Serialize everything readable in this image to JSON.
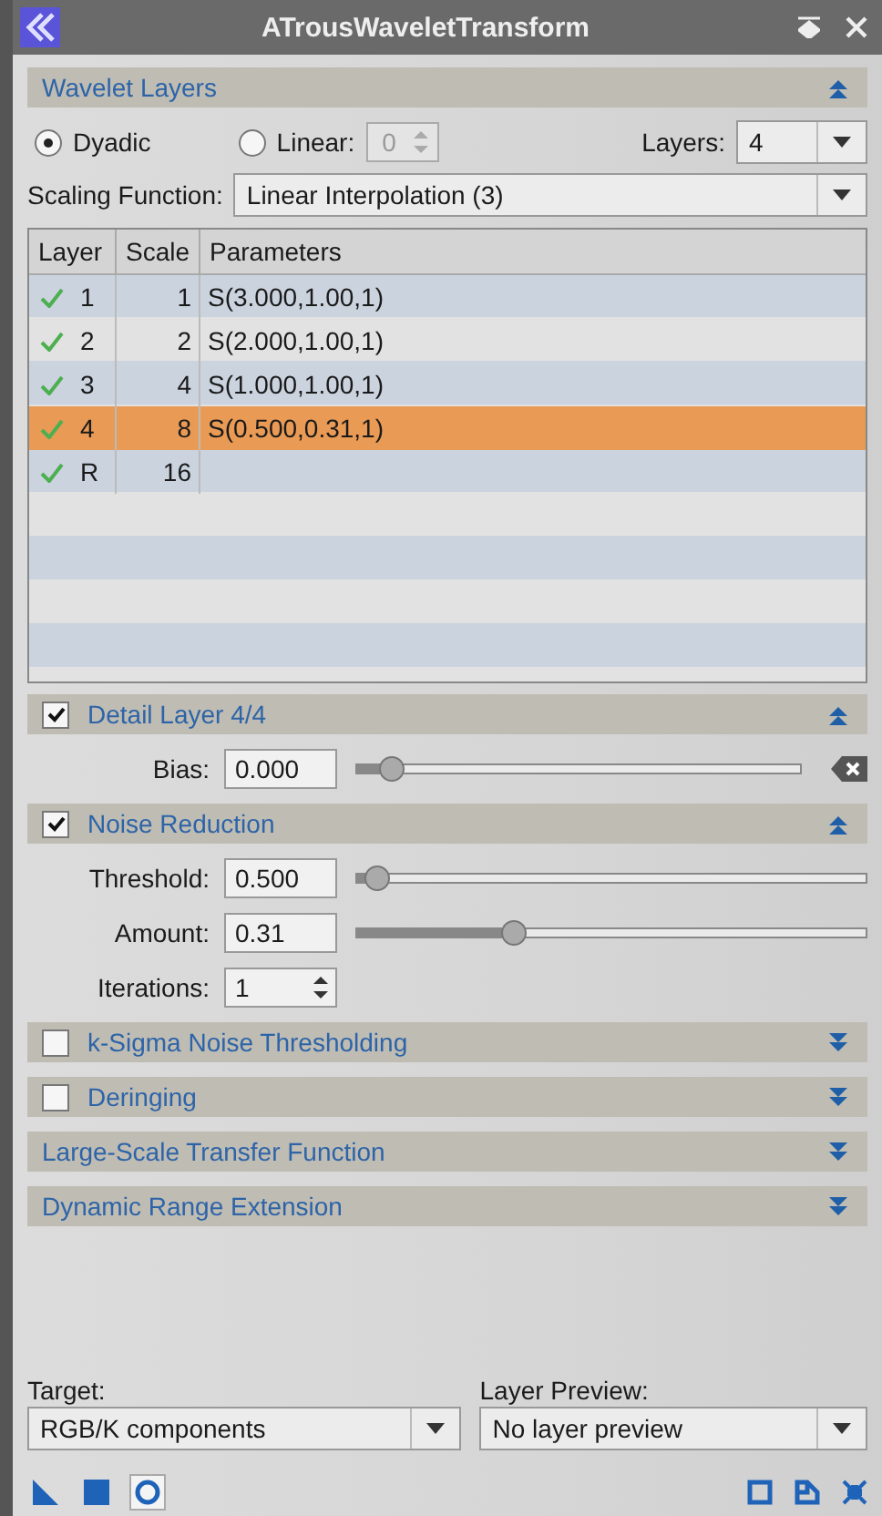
{
  "window": {
    "title": "ATrousWaveletTransform"
  },
  "wavelet_layers": {
    "title": "Wavelet Layers",
    "expanded": true,
    "modes": [
      {
        "label": "Dyadic",
        "selected": true
      },
      {
        "label": "Linear:",
        "selected": false,
        "value": "0"
      }
    ],
    "layers": {
      "label": "Layers:",
      "value": "4"
    },
    "scaling_function": {
      "label": "Scaling Function:",
      "value": "Linear Interpolation (3)"
    },
    "table": {
      "columns": [
        "Layer",
        "Scale",
        "Parameters"
      ],
      "rows": [
        {
          "enabled": true,
          "layer": "1",
          "scale": "1",
          "parameters": "S(3.000,1.00,1)",
          "selected": false
        },
        {
          "enabled": true,
          "layer": "2",
          "scale": "2",
          "parameters": "S(2.000,1.00,1)",
          "selected": false
        },
        {
          "enabled": true,
          "layer": "3",
          "scale": "4",
          "parameters": "S(1.000,1.00,1)",
          "selected": false
        },
        {
          "enabled": true,
          "layer": "4",
          "scale": "8",
          "parameters": "S(0.500,0.31,1)",
          "selected": true
        },
        {
          "enabled": true,
          "layer": "R",
          "scale": "16",
          "selected": false
        }
      ]
    }
  },
  "detail_layer": {
    "title": "Detail Layer 4/4",
    "checked": true,
    "expanded": true,
    "bias": {
      "label": "Bias:",
      "value": "0.000",
      "level": 0.08
    }
  },
  "noise_reduction": {
    "title": "Noise Reduction",
    "checked": true,
    "expanded": true,
    "threshold": {
      "label": "Threshold:",
      "value": "0.500",
      "level": 0.04
    },
    "amount": {
      "label": "Amount:",
      "value": "0.31",
      "level": 0.31
    },
    "iterations": {
      "label": "Iterations:",
      "value": "1"
    }
  },
  "collapsed_sections": [
    {
      "kind": "checkbox",
      "title": "k-Sigma Noise Thresholding",
      "checked": false,
      "expanded": false
    },
    {
      "kind": "checkbox",
      "title": "Deringing",
      "checked": false,
      "expanded": false
    },
    {
      "kind": "plain",
      "title": "Large-Scale Transfer Function",
      "expanded": false
    },
    {
      "kind": "plain",
      "title": "Dynamic Range Extension",
      "expanded": false
    }
  ],
  "target": {
    "label": "Target:",
    "value": "RGB/K components"
  },
  "layer_preview": {
    "label": "Layer Preview:",
    "value": "No layer preview"
  },
  "footer": {
    "left_tools": [
      {
        "kind": "triangle",
        "selected": false
      },
      {
        "kind": "square",
        "selected": false
      },
      {
        "kind": "circle",
        "selected": true
      }
    ],
    "right_tools": [
      {
        "kind": "square"
      },
      {
        "kind": "page"
      },
      {
        "kind": "collapse"
      }
    ]
  }
}
